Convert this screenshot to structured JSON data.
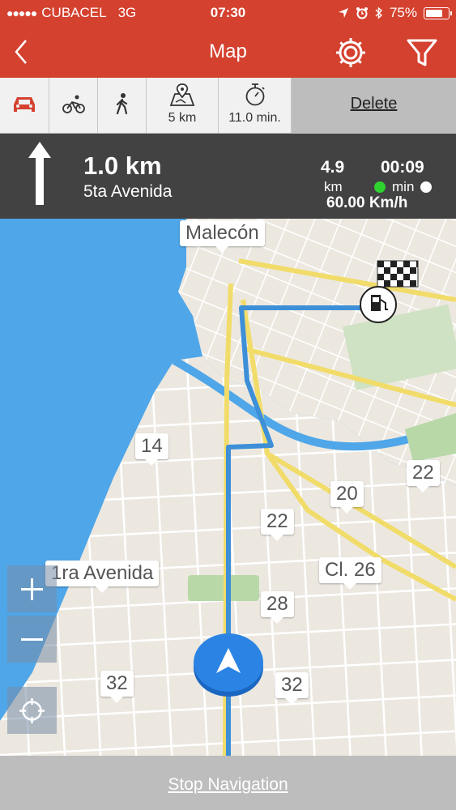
{
  "status_bar": {
    "carrier": "CUBACEL",
    "network": "3G",
    "time": "07:30",
    "battery": "75%"
  },
  "header": {
    "title": "Map"
  },
  "modes": [
    {
      "name": "car",
      "label": ""
    },
    {
      "name": "bike",
      "label": ""
    },
    {
      "name": "walk",
      "label": ""
    },
    {
      "name": "distance",
      "label": "5 km"
    },
    {
      "name": "time",
      "label": "11.0 min."
    }
  ],
  "delete_label": "Delete",
  "direction": {
    "distance": "1.0 km",
    "street": "5ta Avenida"
  },
  "remaining": {
    "distance_value": "4.9",
    "distance_unit": "km",
    "time_value": "00:09",
    "time_unit": "min",
    "speed": "60.00 Km/h"
  },
  "map_labels": {
    "malecon": "Malecón",
    "l14": "14",
    "l22a": "22",
    "l20": "20",
    "l22b": "22",
    "ave1ra": "1ra Avenida",
    "cl26": "Cl. 26",
    "l28": "28",
    "l32a": "32",
    "l32b": "32"
  },
  "bottom": {
    "stop_label": "Stop Navigation"
  },
  "colors": {
    "header": "#d4412f",
    "route": "#3d8fd8",
    "water": "#4fa6e8"
  }
}
